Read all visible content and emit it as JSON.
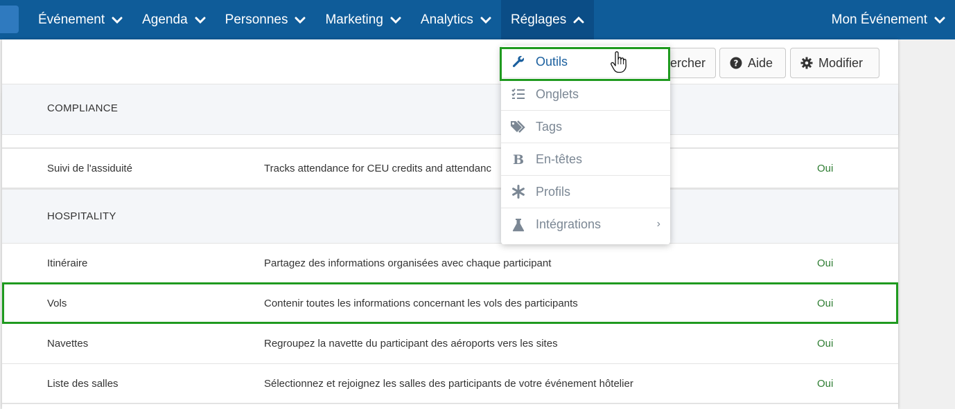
{
  "nav": {
    "items": [
      {
        "label": "Événement",
        "active": false
      },
      {
        "label": "Agenda",
        "active": false
      },
      {
        "label": "Personnes",
        "active": false
      },
      {
        "label": "Marketing",
        "active": false
      },
      {
        "label": "Analytics",
        "active": false
      },
      {
        "label": "Réglages",
        "active": true
      }
    ],
    "right_label": "Mon Événement"
  },
  "toolbar": {
    "search_label": "ercher",
    "help_label": "Aide",
    "edit_label": "Modifier"
  },
  "sections": {
    "compliance": "COMPLIANCE",
    "hospitality": "HOSPITALITY"
  },
  "rows": [
    {
      "name": "Suivi de l'assiduité",
      "desc": "Tracks attendance for CEU credits and attendanc",
      "status": "Oui"
    },
    {
      "name": "Itinéraire",
      "desc": "Partagez des informations organisées avec chaque participant",
      "status": "Oui"
    },
    {
      "name": "Vols",
      "desc": "Contenir toutes les informations concernant les vols des participants",
      "status": "Oui"
    },
    {
      "name": "Navettes",
      "desc": "Regroupez la navette du participant des aéroports vers les sites",
      "status": "Oui"
    },
    {
      "name": "Liste des salles",
      "desc": "Sélectionnez et rejoignez les salles des participants de votre événement hôtelier",
      "status": "Oui"
    }
  ],
  "dropdown": {
    "items": [
      {
        "label": "Outils",
        "icon": "wrench-icon"
      },
      {
        "label": "Onglets",
        "icon": "checklist-icon"
      },
      {
        "label": "Tags",
        "icon": "tags-icon"
      },
      {
        "label": "En-têtes",
        "icon": "bold-icon"
      },
      {
        "label": "Profils",
        "icon": "asterisk-icon"
      },
      {
        "label": "Intégrations",
        "icon": "flask-icon"
      }
    ],
    "submenu_arrow": "›"
  },
  "colors": {
    "nav_bg": "#0f5c99",
    "nav_active": "#0b4d86",
    "highlight": "#1f9a1f",
    "status_green": "#2e7d32",
    "link_blue": "#1a5f9e"
  }
}
